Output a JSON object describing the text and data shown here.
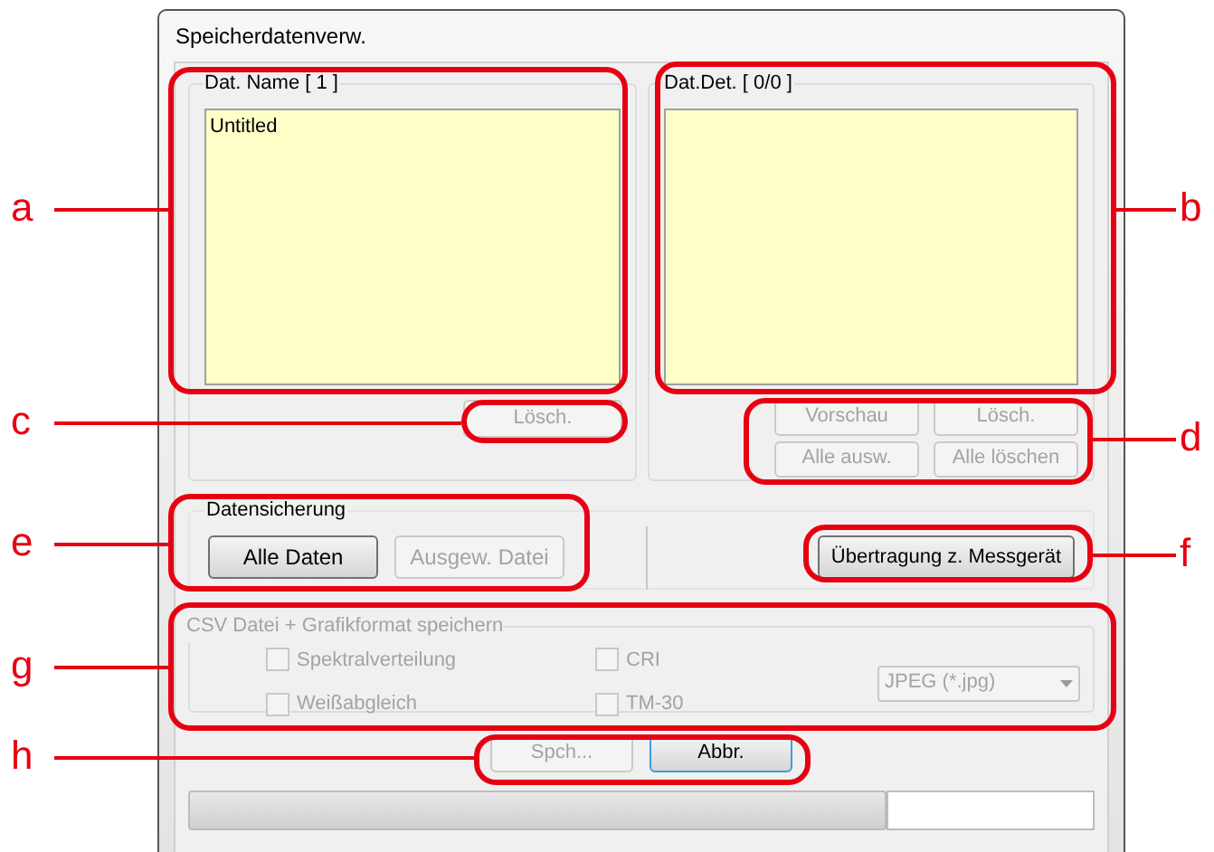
{
  "window": {
    "title": "Speicherdatenverw."
  },
  "name_group": {
    "label": "Dat. Name [ 1 ]",
    "items": [
      "Untitled"
    ],
    "buttons": [
      {
        "label": "Lösch.",
        "disabled": true
      }
    ]
  },
  "detail_group": {
    "label": "Dat.Det. [ 0/0 ]",
    "buttons": [
      {
        "label": "Vorschau",
        "disabled": true
      },
      {
        "label": "Lösch.",
        "disabled": true
      },
      {
        "label": "Alle ausw.",
        "disabled": true
      },
      {
        "label": "Alle löschen",
        "disabled": true
      }
    ]
  },
  "backup_group": {
    "label": "Datensicherung",
    "buttons": [
      {
        "label": "Alle Daten",
        "disabled": false
      },
      {
        "label": "Ausgew. Datei",
        "disabled": true
      }
    ]
  },
  "transfer_button": {
    "label": "Übertragung z. Messgerät",
    "disabled": false
  },
  "csv_group": {
    "label": "CSV Datei + Grafikformat speichern",
    "disabled": true,
    "checkboxes": [
      {
        "label": "Spektralverteilung",
        "checked": false
      },
      {
        "label": "CRI",
        "checked": false
      },
      {
        "label": "Weißabgleich",
        "checked": false
      },
      {
        "label": "TM-30",
        "checked": false
      }
    ],
    "format": {
      "value": "JPEG (*.jpg)"
    }
  },
  "footer_buttons": [
    {
      "label": "Spch...",
      "disabled": true,
      "focused": false
    },
    {
      "label": "Abbr.",
      "disabled": false,
      "focused": true
    }
  ],
  "callouts": [
    {
      "label": "a"
    },
    {
      "label": "b"
    },
    {
      "label": "c"
    },
    {
      "label": "d"
    },
    {
      "label": "e"
    },
    {
      "label": "f"
    },
    {
      "label": "g"
    },
    {
      "label": "h"
    }
  ]
}
